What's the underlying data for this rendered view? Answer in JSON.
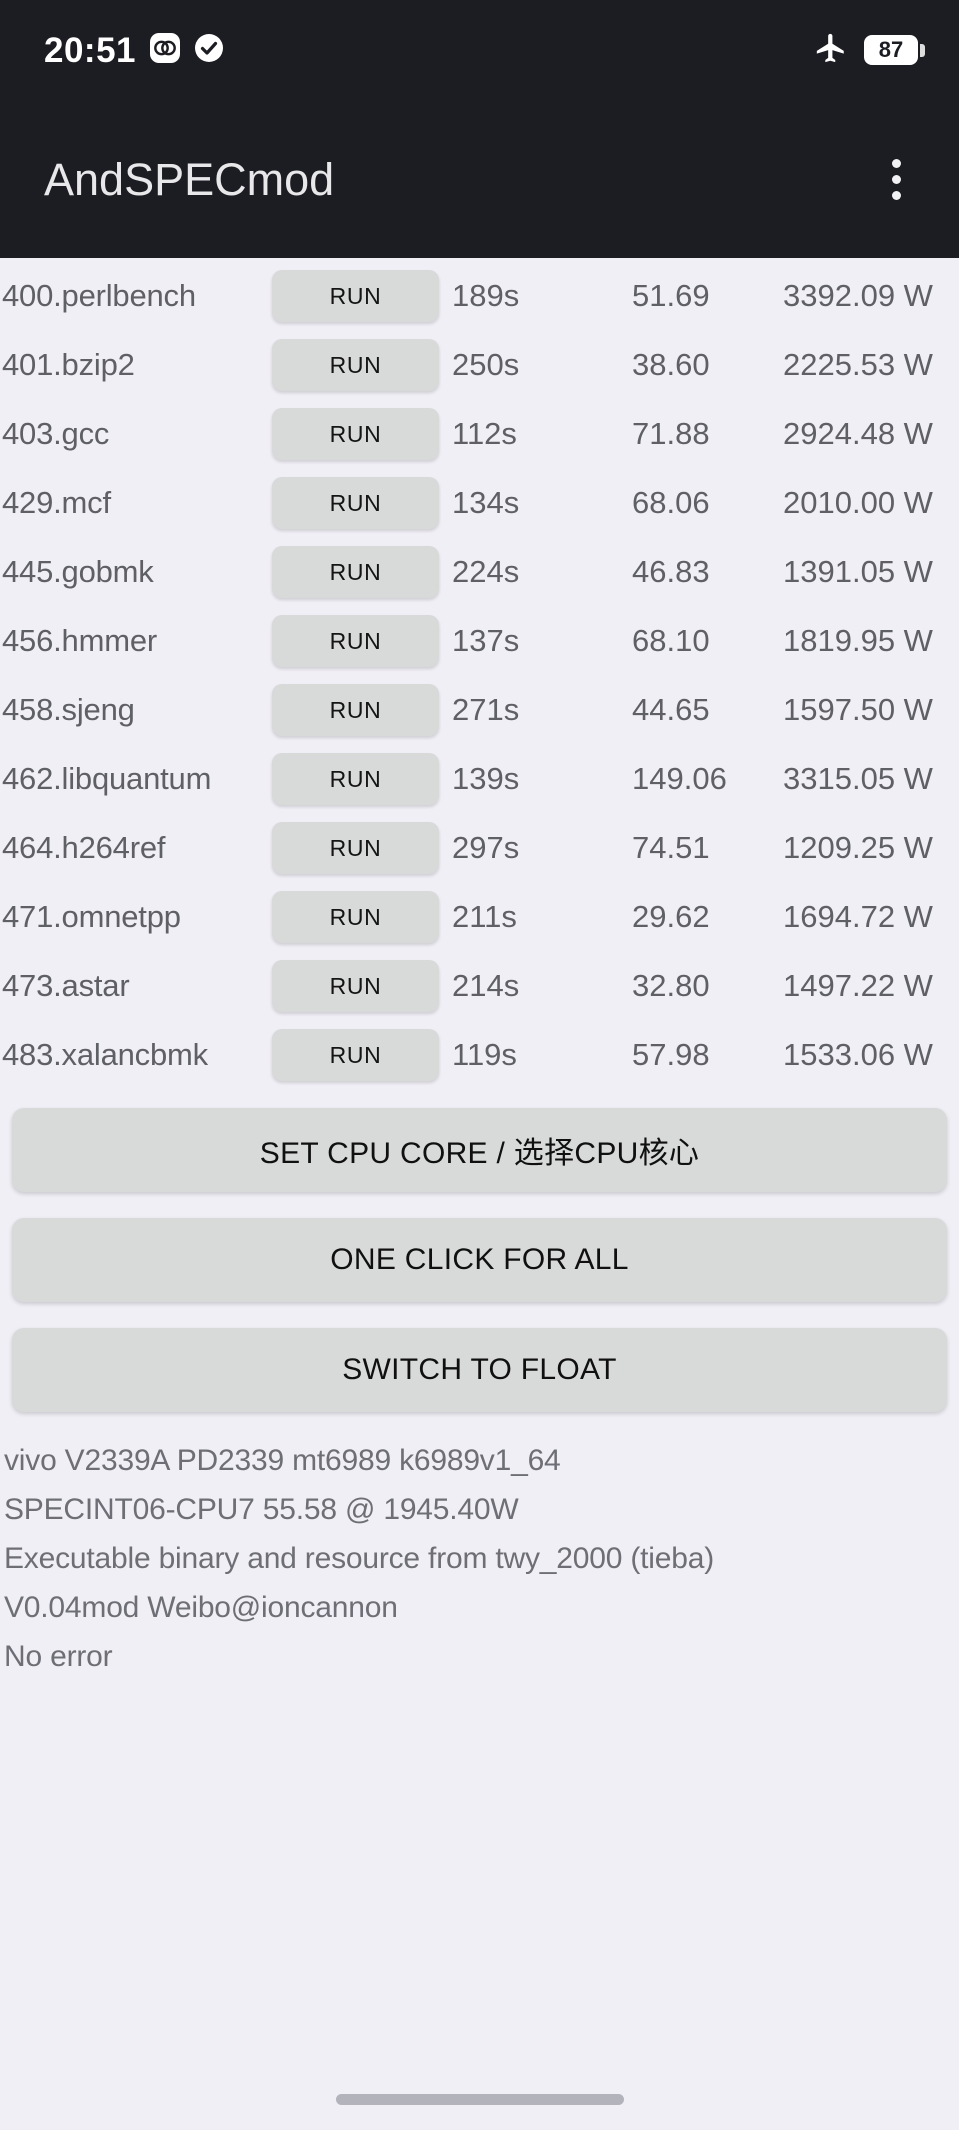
{
  "status_bar": {
    "time": "20:51",
    "icons": [
      "dual-circle-icon",
      "check-circle-icon"
    ],
    "airplane_mode": "airplane-mode-icon",
    "battery_level": "87"
  },
  "app_bar": {
    "title": "AndSPECmod",
    "overflow_menu": "overflow-menu-icon"
  },
  "benchmarks": {
    "run_label": "RUN",
    "rows": [
      {
        "name": "400.perlbench",
        "time": "189s",
        "score": "51.69",
        "power": "3392.09 W"
      },
      {
        "name": "401.bzip2",
        "time": "250s",
        "score": "38.60",
        "power": "2225.53 W"
      },
      {
        "name": "403.gcc",
        "time": "112s",
        "score": "71.88",
        "power": "2924.48 W"
      },
      {
        "name": "429.mcf",
        "time": "134s",
        "score": "68.06",
        "power": "2010.00 W"
      },
      {
        "name": "445.gobmk",
        "time": "224s",
        "score": "46.83",
        "power": "1391.05 W"
      },
      {
        "name": "456.hmmer",
        "time": "137s",
        "score": "68.10",
        "power": "1819.95 W"
      },
      {
        "name": "458.sjeng",
        "time": "271s",
        "score": "44.65",
        "power": "1597.50 W"
      },
      {
        "name": "462.libquantum",
        "time": "139s",
        "score": "149.06",
        "power": "3315.05 W"
      },
      {
        "name": "464.h264ref",
        "time": "297s",
        "score": "74.51",
        "power": "1209.25 W"
      },
      {
        "name": "471.omnetpp",
        "time": "211s",
        "score": "29.62",
        "power": "1694.72 W"
      },
      {
        "name": "473.astar",
        "time": "214s",
        "score": "32.80",
        "power": "1497.22 W"
      },
      {
        "name": "483.xalancbmk",
        "time": "119s",
        "score": "57.98",
        "power": "1533.06 W"
      }
    ]
  },
  "actions": {
    "set_cpu_core": "SET CPU CORE / 选择CPU核心",
    "one_click_for_all": "ONE CLICK FOR ALL",
    "switch_to_float": "SWITCH TO FLOAT"
  },
  "footer": {
    "lines": [
      "vivo V2339A PD2339 mt6989 k6989v1_64",
      "SPECINT06-CPU7  55.58 @ 1945.40W",
      "Executable binary and resource from twy_2000 (tieba)",
      "V0.04mod  Weibo@ioncannon",
      "No error"
    ]
  }
}
